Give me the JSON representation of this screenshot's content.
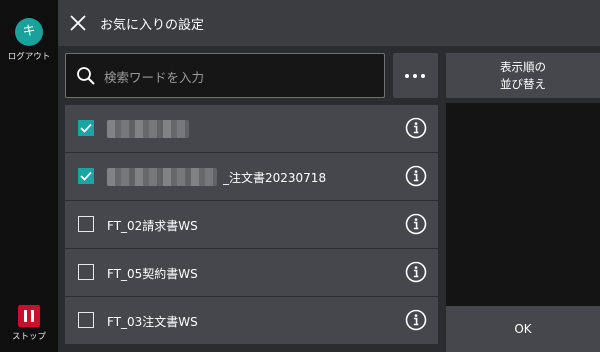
{
  "sidebar": {
    "logout_icon_glyph": "キ",
    "logout_label": "ログアウト",
    "stop_label": "ストップ"
  },
  "header": {
    "title": "お気に入りの設定"
  },
  "search": {
    "placeholder": "検索ワードを入力",
    "value": ""
  },
  "sort_button": {
    "line1": "表示順の",
    "line2": "並び替え"
  },
  "ok_label": "OK",
  "list": {
    "items": [
      {
        "label": "",
        "checked": true
      },
      {
        "label": "_注文書20230718",
        "checked": true
      },
      {
        "label": "FT_02請求書WS",
        "checked": false
      },
      {
        "label": "FT_05契約書WS",
        "checked": false
      },
      {
        "label": "FT_03注文書WS",
        "checked": false
      }
    ]
  },
  "colors": {
    "accent": "#17a6a3",
    "stop": "#c8102e",
    "panel": "#45474c",
    "header": "#3b3d41"
  }
}
